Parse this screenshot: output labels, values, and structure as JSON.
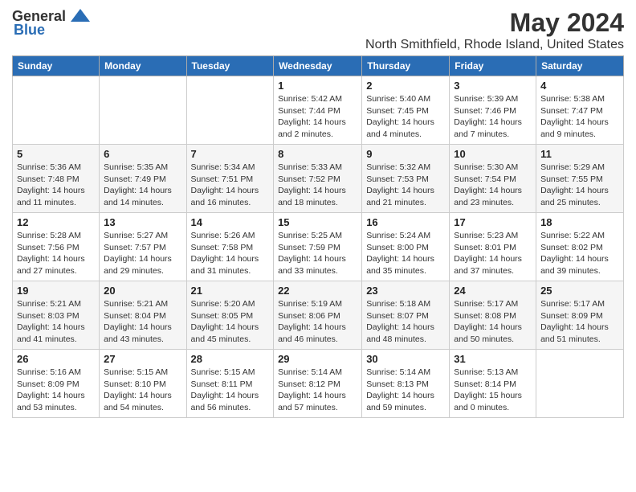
{
  "logo": {
    "general": "General",
    "blue": "Blue"
  },
  "header": {
    "title": "May 2024",
    "subtitle": "North Smithfield, Rhode Island, United States"
  },
  "weekdays": [
    "Sunday",
    "Monday",
    "Tuesday",
    "Wednesday",
    "Thursday",
    "Friday",
    "Saturday"
  ],
  "weeks": [
    [
      {
        "day": "",
        "info": ""
      },
      {
        "day": "",
        "info": ""
      },
      {
        "day": "",
        "info": ""
      },
      {
        "day": "1",
        "info": "Sunrise: 5:42 AM\nSunset: 7:44 PM\nDaylight: 14 hours\nand 2 minutes."
      },
      {
        "day": "2",
        "info": "Sunrise: 5:40 AM\nSunset: 7:45 PM\nDaylight: 14 hours\nand 4 minutes."
      },
      {
        "day": "3",
        "info": "Sunrise: 5:39 AM\nSunset: 7:46 PM\nDaylight: 14 hours\nand 7 minutes."
      },
      {
        "day": "4",
        "info": "Sunrise: 5:38 AM\nSunset: 7:47 PM\nDaylight: 14 hours\nand 9 minutes."
      }
    ],
    [
      {
        "day": "5",
        "info": "Sunrise: 5:36 AM\nSunset: 7:48 PM\nDaylight: 14 hours\nand 11 minutes."
      },
      {
        "day": "6",
        "info": "Sunrise: 5:35 AM\nSunset: 7:49 PM\nDaylight: 14 hours\nand 14 minutes."
      },
      {
        "day": "7",
        "info": "Sunrise: 5:34 AM\nSunset: 7:51 PM\nDaylight: 14 hours\nand 16 minutes."
      },
      {
        "day": "8",
        "info": "Sunrise: 5:33 AM\nSunset: 7:52 PM\nDaylight: 14 hours\nand 18 minutes."
      },
      {
        "day": "9",
        "info": "Sunrise: 5:32 AM\nSunset: 7:53 PM\nDaylight: 14 hours\nand 21 minutes."
      },
      {
        "day": "10",
        "info": "Sunrise: 5:30 AM\nSunset: 7:54 PM\nDaylight: 14 hours\nand 23 minutes."
      },
      {
        "day": "11",
        "info": "Sunrise: 5:29 AM\nSunset: 7:55 PM\nDaylight: 14 hours\nand 25 minutes."
      }
    ],
    [
      {
        "day": "12",
        "info": "Sunrise: 5:28 AM\nSunset: 7:56 PM\nDaylight: 14 hours\nand 27 minutes."
      },
      {
        "day": "13",
        "info": "Sunrise: 5:27 AM\nSunset: 7:57 PM\nDaylight: 14 hours\nand 29 minutes."
      },
      {
        "day": "14",
        "info": "Sunrise: 5:26 AM\nSunset: 7:58 PM\nDaylight: 14 hours\nand 31 minutes."
      },
      {
        "day": "15",
        "info": "Sunrise: 5:25 AM\nSunset: 7:59 PM\nDaylight: 14 hours\nand 33 minutes."
      },
      {
        "day": "16",
        "info": "Sunrise: 5:24 AM\nSunset: 8:00 PM\nDaylight: 14 hours\nand 35 minutes."
      },
      {
        "day": "17",
        "info": "Sunrise: 5:23 AM\nSunset: 8:01 PM\nDaylight: 14 hours\nand 37 minutes."
      },
      {
        "day": "18",
        "info": "Sunrise: 5:22 AM\nSunset: 8:02 PM\nDaylight: 14 hours\nand 39 minutes."
      }
    ],
    [
      {
        "day": "19",
        "info": "Sunrise: 5:21 AM\nSunset: 8:03 PM\nDaylight: 14 hours\nand 41 minutes."
      },
      {
        "day": "20",
        "info": "Sunrise: 5:21 AM\nSunset: 8:04 PM\nDaylight: 14 hours\nand 43 minutes."
      },
      {
        "day": "21",
        "info": "Sunrise: 5:20 AM\nSunset: 8:05 PM\nDaylight: 14 hours\nand 45 minutes."
      },
      {
        "day": "22",
        "info": "Sunrise: 5:19 AM\nSunset: 8:06 PM\nDaylight: 14 hours\nand 46 minutes."
      },
      {
        "day": "23",
        "info": "Sunrise: 5:18 AM\nSunset: 8:07 PM\nDaylight: 14 hours\nand 48 minutes."
      },
      {
        "day": "24",
        "info": "Sunrise: 5:17 AM\nSunset: 8:08 PM\nDaylight: 14 hours\nand 50 minutes."
      },
      {
        "day": "25",
        "info": "Sunrise: 5:17 AM\nSunset: 8:09 PM\nDaylight: 14 hours\nand 51 minutes."
      }
    ],
    [
      {
        "day": "26",
        "info": "Sunrise: 5:16 AM\nSunset: 8:09 PM\nDaylight: 14 hours\nand 53 minutes."
      },
      {
        "day": "27",
        "info": "Sunrise: 5:15 AM\nSunset: 8:10 PM\nDaylight: 14 hours\nand 54 minutes."
      },
      {
        "day": "28",
        "info": "Sunrise: 5:15 AM\nSunset: 8:11 PM\nDaylight: 14 hours\nand 56 minutes."
      },
      {
        "day": "29",
        "info": "Sunrise: 5:14 AM\nSunset: 8:12 PM\nDaylight: 14 hours\nand 57 minutes."
      },
      {
        "day": "30",
        "info": "Sunrise: 5:14 AM\nSunset: 8:13 PM\nDaylight: 14 hours\nand 59 minutes."
      },
      {
        "day": "31",
        "info": "Sunrise: 5:13 AM\nSunset: 8:14 PM\nDaylight: 15 hours\nand 0 minutes."
      },
      {
        "day": "",
        "info": ""
      }
    ]
  ]
}
